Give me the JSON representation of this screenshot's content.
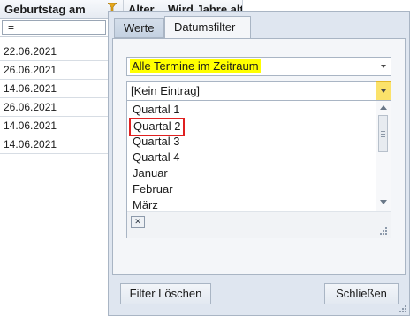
{
  "grid": {
    "columns": [
      "Geburtstag am",
      "Alter",
      "Wird Jahre alt"
    ],
    "filter_value": "=",
    "rows": [
      "22.06.2021",
      "26.06.2021",
      "14.06.2021",
      "26.06.2021",
      "14.06.2021",
      "14.06.2021"
    ]
  },
  "popup": {
    "tabs": [
      "Werte",
      "Datumsfilter"
    ],
    "active_tab": "Datumsfilter",
    "period_combo": "Alle Termine im Zeitraum",
    "value_combo": "[Kein Eintrag]",
    "options": [
      "Quartal 1",
      "Quartal 2",
      "Quartal 3",
      "Quartal 4",
      "Januar",
      "Februar",
      "März"
    ],
    "selected_option": "Quartal 2",
    "clear_button_glyph": "✕",
    "buttons": {
      "clear_filter": "Filter Löschen",
      "close": "Schließen"
    }
  },
  "colors": {
    "highlight": "#ffff00",
    "selection_border": "#e02020",
    "active_dropdown_button": "#fbe26a"
  }
}
